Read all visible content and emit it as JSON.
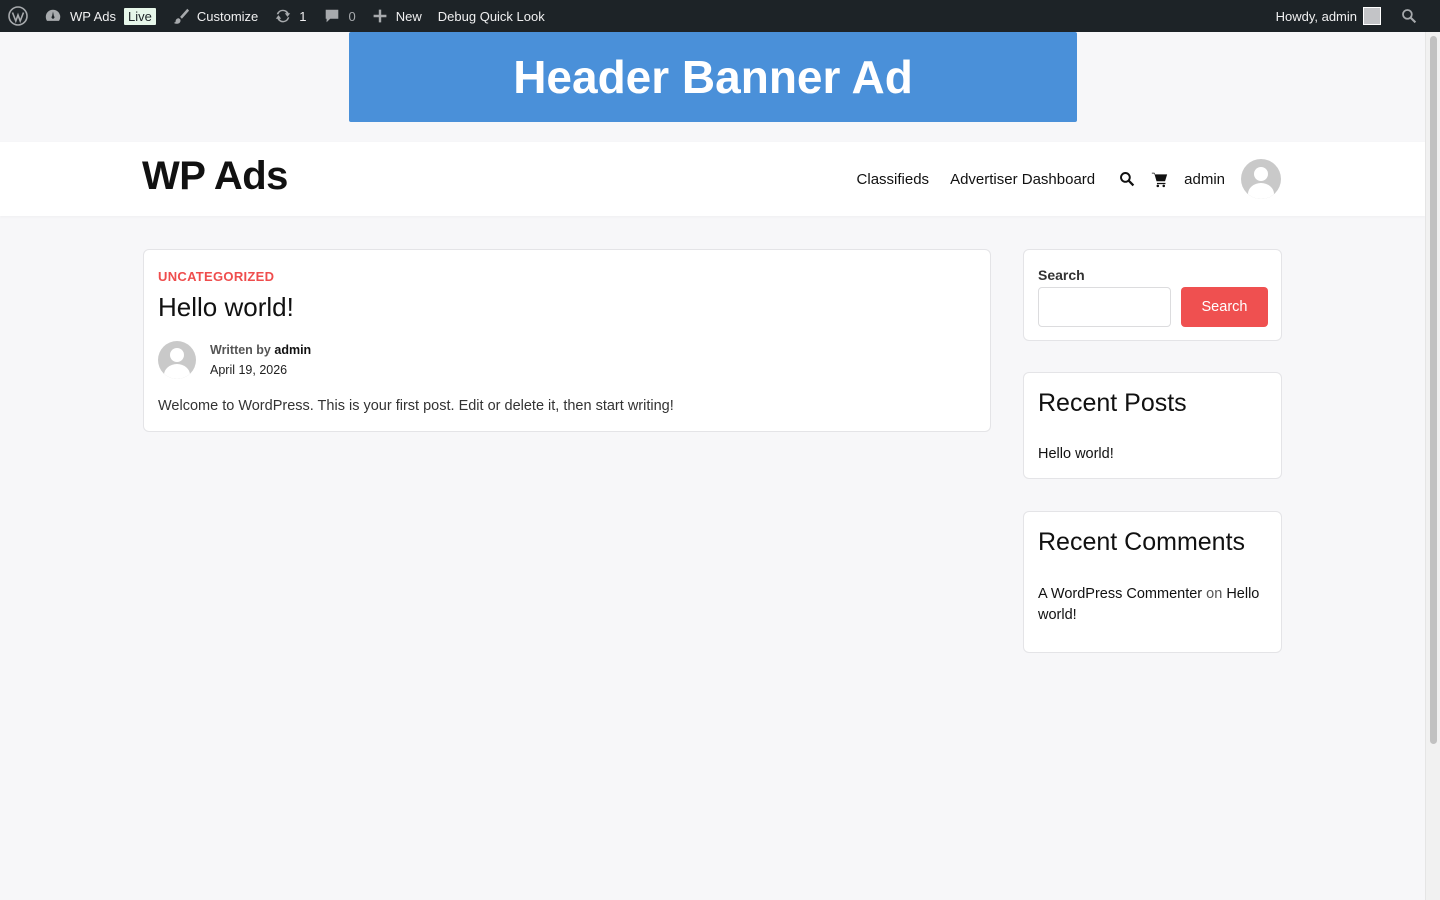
{
  "adminbar": {
    "site_name": "WP Ads",
    "live_badge": "Live",
    "customize": "Customize",
    "updates_count": "1",
    "comments_count": "0",
    "new_label": "New",
    "debug_label": "Debug Quick Look",
    "howdy": "Howdy, admin"
  },
  "banner": {
    "text": "Header Banner Ad",
    "color": "#4a90d9"
  },
  "header": {
    "site_title": "WP Ads",
    "nav": [
      "Classifieds",
      "Advertiser Dashboard"
    ],
    "user": "admin"
  },
  "post": {
    "category": "UNCATEGORIZED",
    "title": "Hello world!",
    "written_by": "Written by",
    "author": "admin",
    "date": "April 19, 2026",
    "excerpt": "Welcome to WordPress. This is your first post. Edit or delete it, then start writing!"
  },
  "sidebar": {
    "search": {
      "label": "Search",
      "value": "",
      "button": "Search"
    },
    "recent_posts": {
      "title": "Recent Posts",
      "items": [
        "Hello world!"
      ]
    },
    "recent_comments": {
      "title": "Recent Comments",
      "author": "A WordPress Commenter",
      "on": "on",
      "post": "Hello world!"
    }
  },
  "colors": {
    "accent": "#ef5050",
    "adminbar_bg": "#1d2327"
  }
}
